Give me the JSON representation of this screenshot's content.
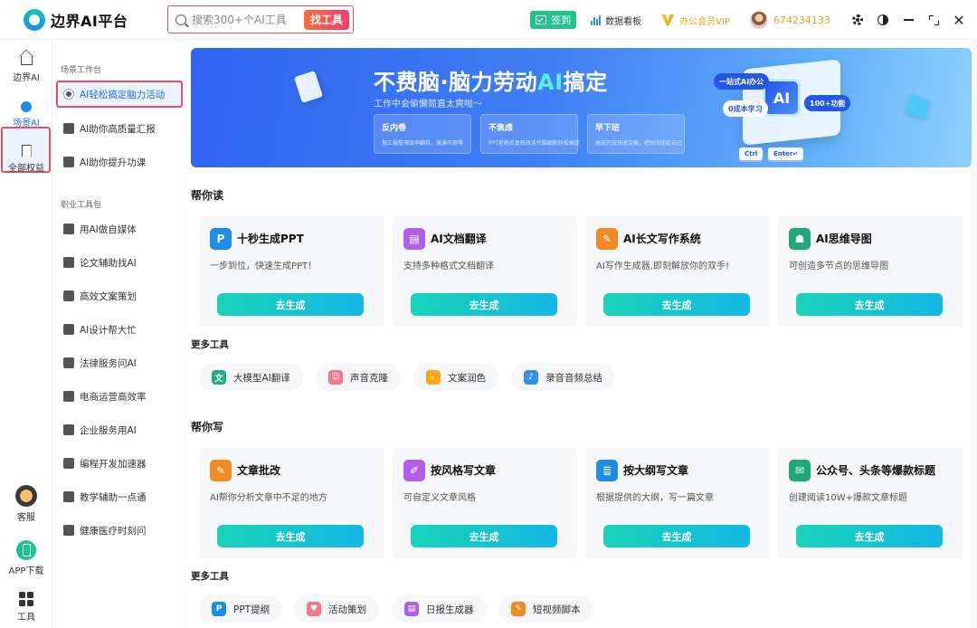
{
  "app": {
    "title": "边界AI平台"
  },
  "search": {
    "placeholder": "搜索300+个AI工具",
    "button": "找工具"
  },
  "toolbar": {
    "signin": "签到",
    "dashboard": "数据看板",
    "vip": "办公会员VIP",
    "user_id": "674234133"
  },
  "rail": {
    "items": [
      {
        "label": "边界AI",
        "icon": "home-icon"
      },
      {
        "label": "场景AI",
        "icon": "bulb-icon",
        "active": true
      },
      {
        "label": "全部权益",
        "icon": "bookmark-icon"
      }
    ],
    "bottom": [
      {
        "label": "客服",
        "icon": "customer-service-icon"
      },
      {
        "label": "APP下载",
        "icon": "app-download-icon"
      },
      {
        "label": "工具",
        "icon": "tools-grid-icon"
      }
    ]
  },
  "menu": {
    "groups": [
      {
        "title": "场景工作台",
        "items": [
          {
            "label": "AI轻松搞定脑力活动",
            "active": true
          },
          {
            "label": "AI助你高质量汇报"
          },
          {
            "label": "AI助你提升功课"
          }
        ]
      },
      {
        "title": "职业工具包",
        "items": [
          {
            "label": "用AI做自媒体"
          },
          {
            "label": "论文辅助找AI"
          },
          {
            "label": "高效文案策划"
          },
          {
            "label": "AI设计帮大忙"
          },
          {
            "label": "法律服务问AI"
          },
          {
            "label": "电商运营高效率"
          },
          {
            "label": "企业服务用AI"
          },
          {
            "label": "编程开发加速器"
          },
          {
            "label": "教学辅助一点通"
          },
          {
            "label": "健康医疗时刻问"
          }
        ]
      }
    ]
  },
  "banner": {
    "title_pre": "不费脑·脑力劳动",
    "title_ai": "AI",
    "title_post": "搞定",
    "subtitle": "工作中会偷懒简直太爽啦～",
    "cards": [
      {
        "title": "反内卷",
        "desc": "做汇报整理效率翻倍，速通不用等"
      },
      {
        "title": "不焦虑",
        "desc": "PPT拒绝反复修改迭代脑细胞轻松搞定"
      },
      {
        "title": "早下班",
        "desc": "高效完成快速交稿，把时间还给自己"
      }
    ],
    "deco": {
      "pill1": "一站式AI办公",
      "pill2": "0成本学习",
      "pill3": "100+功能",
      "chip": "AI",
      "key1": "Ctrl",
      "key2": "Enter↵"
    }
  },
  "sections": [
    {
      "title": "帮你读",
      "cards": [
        {
          "title": "十秒生成PPT",
          "desc": "一步到位，快速生成PPT！",
          "button": "去生成",
          "icon": "ppt-icon",
          "color": "#1f8de8",
          "glyph": "P"
        },
        {
          "title": "AI文档翻译",
          "desc": "支持多种格式文档翻译",
          "button": "去生成",
          "icon": "doc-translate-icon",
          "color": "#b25fe8",
          "glyph": "▤"
        },
        {
          "title": "AI长文写作系统",
          "desc": "AI写作生成器,即刻解放你的双手!",
          "button": "去生成",
          "icon": "pen-icon",
          "color": "#f08a24",
          "glyph": "✎"
        },
        {
          "title": "AI思维导图",
          "desc": "可创造多节点的思维导图",
          "button": "去生成",
          "icon": "mindmap-icon",
          "color": "#1fa97a",
          "glyph": "☗"
        }
      ],
      "more_title": "更多工具",
      "more": [
        {
          "label": "大模型AI翻译",
          "icon": "translate-icon",
          "color": "#22b07d",
          "glyph": "文"
        },
        {
          "label": "声音克隆",
          "icon": "voice-clone-icon",
          "color": "#f07a8a",
          "glyph": "☺"
        },
        {
          "label": "文案润色",
          "icon": "polish-icon",
          "color": "#f5a623",
          "glyph": "✋"
        },
        {
          "label": "录音音频总结",
          "icon": "mic-icon",
          "color": "#3a8ee6",
          "glyph": "♪"
        }
      ]
    },
    {
      "title": "帮你写",
      "cards": [
        {
          "title": "文章批改",
          "desc": "AI帮你分析文章中不足的地方",
          "button": "去生成",
          "icon": "article-review-icon",
          "color": "#f08a24",
          "glyph": "✎"
        },
        {
          "title": "按风格写文章",
          "desc": "可自定义文章风格",
          "button": "去生成",
          "icon": "style-write-icon",
          "color": "#b25fe8",
          "glyph": "✐"
        },
        {
          "title": "按大纲写文章",
          "desc": "根据提供的大纲，写一篇文章",
          "button": "去生成",
          "icon": "outline-write-icon",
          "color": "#1f8de8",
          "glyph": "≣"
        },
        {
          "title": "公众号、头条等爆款标题",
          "desc": "创建阅读10W+爆款文章标题",
          "button": "去生成",
          "icon": "wechat-icon",
          "color": "#1fa97a",
          "glyph": "✉"
        }
      ],
      "more_title": "更多工具",
      "more": [
        {
          "label": "PPT提纲",
          "icon": "ppt-outline-icon",
          "color": "#1f8de8",
          "glyph": "P"
        },
        {
          "label": "活动策划",
          "icon": "event-plan-icon",
          "color": "#f07a8a",
          "glyph": "♥"
        },
        {
          "label": "日报生成器",
          "icon": "daily-report-icon",
          "color": "#b25fe8",
          "glyph": "▤"
        },
        {
          "label": "短视频脚本",
          "icon": "video-script-icon",
          "color": "#f08a24",
          "glyph": "✎"
        }
      ]
    }
  ]
}
